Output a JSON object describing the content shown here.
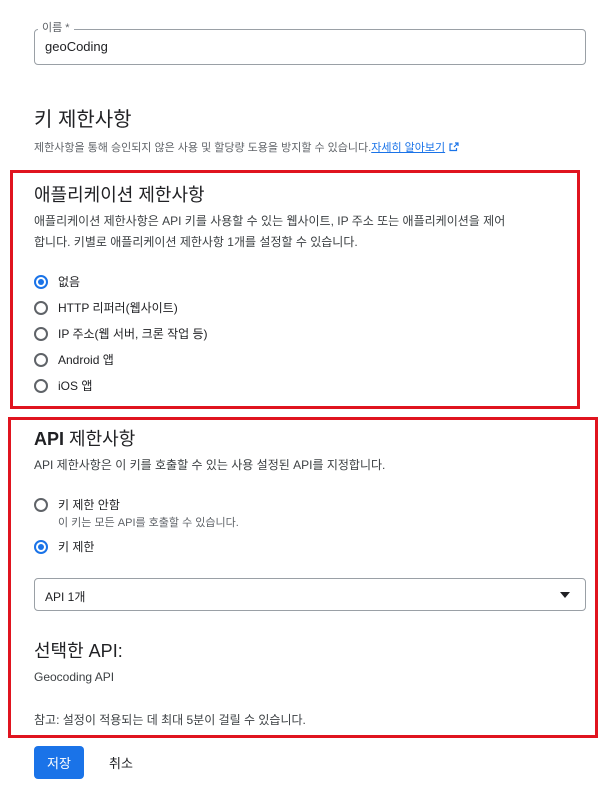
{
  "name_field": {
    "label": "이름 *",
    "value": "geoCoding"
  },
  "key_restrictions": {
    "title": "키 제한사항",
    "description": "제한사항을 통해 승인되지 않은 사용 및 할당량 도용을 방지할 수 있습니다.",
    "learn_more": "자세히 알아보기",
    "icon": "external-link-icon"
  },
  "app_restrictions": {
    "title": "애플리케이션 제한사항",
    "description_line1": "애플리케이션 제한사항은 API 키를 사용할 수 있는 웹사이트, IP 주소 또는 애플리케이션을 제어",
    "description_line2": "합니다. 키별로 애플리케이션 제한사항 1개를 설정할 수 있습니다.",
    "options": [
      {
        "label": "없음",
        "checked": true
      },
      {
        "label": "HTTP 리퍼러(웹사이트)",
        "checked": false
      },
      {
        "label": "IP 주소(웹 서버, 크론 작업 등)",
        "checked": false
      },
      {
        "label": "Android 앱",
        "checked": false
      },
      {
        "label": "iOS 앱",
        "checked": false
      }
    ]
  },
  "api_restrictions": {
    "title_prefix": "API",
    "title_suffix": " 제한사항",
    "description": "API 제한사항은 이 키를 호출할 수 있는 사용 설정된 API를 지정합니다.",
    "options": [
      {
        "label": "키 제한 안함",
        "sub": "이 키는 모든 API를 호출할 수 있습니다.",
        "checked": false
      },
      {
        "label": "키 제한",
        "checked": true
      }
    ],
    "select_value": "API 1개",
    "selected_title": "선택한 API:",
    "selected_item": "Geocoding API",
    "note": "참고: 설정이 적용되는 데 최대 5분이 걸릴 수 있습니다."
  },
  "actions": {
    "save": "저장",
    "cancel": "취소"
  },
  "colors": {
    "primary": "#1a73e8",
    "highlight_border": "#e0141f"
  }
}
